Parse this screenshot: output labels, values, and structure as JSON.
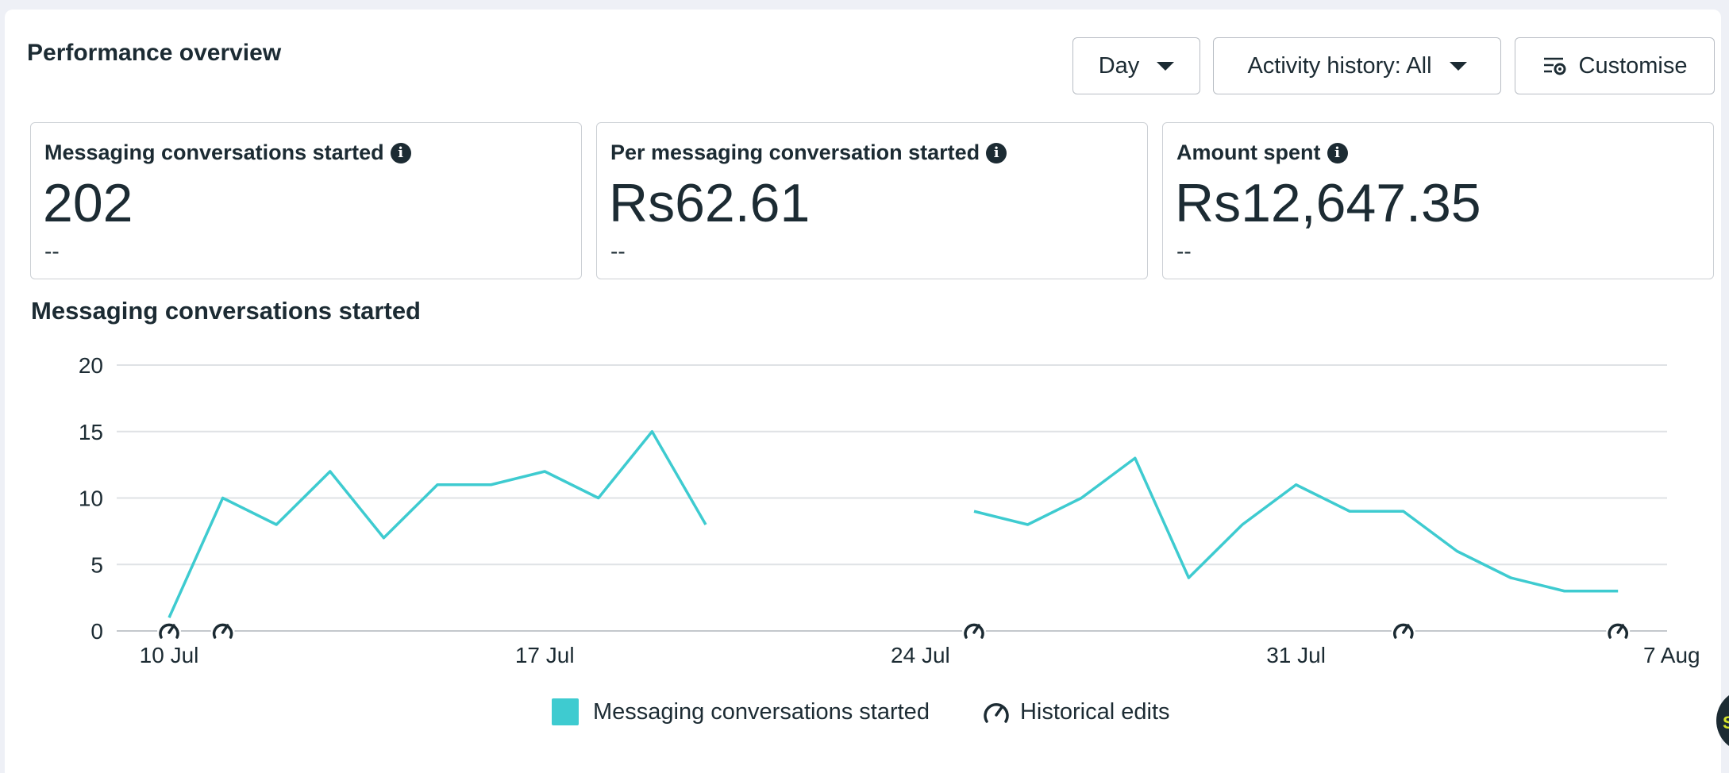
{
  "header": {
    "title": "Performance overview",
    "day_label": "Day",
    "activity_label": "Activity history: All",
    "customise_label": "Customise"
  },
  "cards": [
    {
      "label": "Messaging conversations started",
      "value": "202",
      "delta": "--"
    },
    {
      "label": "Per messaging conversation started",
      "value": "Rs62.61",
      "delta": "--"
    },
    {
      "label": "Amount spent",
      "value": "Rs12,647.35",
      "delta": "--"
    }
  ],
  "info_glyph": "i",
  "chart_title": "Messaging conversations started",
  "chart_data": {
    "type": "line",
    "x_tick_labels": [
      "10 Jul",
      "17 Jul",
      "24 Jul",
      "31 Jul",
      "7 Aug"
    ],
    "y_tick_labels": [
      "0",
      "5",
      "10",
      "15",
      "20"
    ],
    "ylim": [
      0,
      20
    ],
    "x": [
      "10 Jul",
      "11 Jul",
      "12 Jul",
      "13 Jul",
      "14 Jul",
      "15 Jul",
      "16 Jul",
      "17 Jul",
      "18 Jul",
      "19 Jul",
      "20 Jul",
      "21 Jul",
      "22 Jul",
      "23 Jul",
      "24 Jul",
      "25 Jul",
      "26 Jul",
      "27 Jul",
      "28 Jul",
      "29 Jul",
      "30 Jul",
      "31 Jul",
      "1 Aug",
      "2 Aug",
      "3 Aug",
      "4 Aug",
      "5 Aug",
      "6 Aug"
    ],
    "series": [
      {
        "name": "Messaging conversations started",
        "color": "#3ecbd0",
        "values": [
          1,
          10,
          8,
          12,
          7,
          11,
          11,
          12,
          10,
          15,
          8,
          null,
          null,
          null,
          null,
          9,
          8,
          10,
          13,
          4,
          8,
          11,
          9,
          9,
          6,
          4,
          3,
          3
        ]
      }
    ],
    "historical_edits": [
      "10 Jul",
      "11 Jul",
      "25 Jul",
      "2 Aug",
      "6 Aug"
    ],
    "grid": true,
    "legend": [
      {
        "label": "Messaging conversations started",
        "icon": "swatch"
      },
      {
        "label": "Historical edits",
        "icon": "gauge-icon"
      }
    ],
    "legend_position": "bottom"
  },
  "corner_badge": "S"
}
